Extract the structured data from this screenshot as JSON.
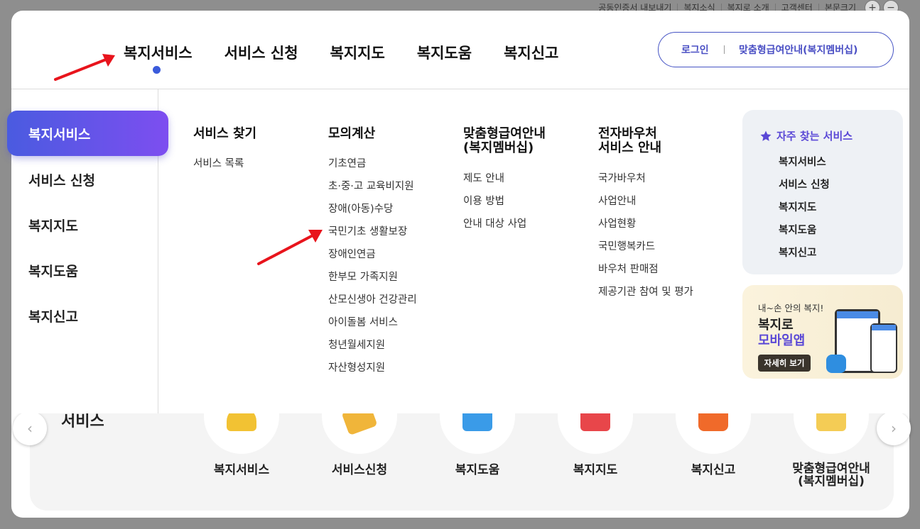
{
  "utility_links": [
    "공동인증서 내보내기",
    "복지소식",
    "복지로 소개",
    "고객센터",
    "본문크기"
  ],
  "zoom": {
    "plus": "+",
    "minus": "−"
  },
  "gnb": [
    "복지서비스",
    "서비스 신청",
    "복지지도",
    "복지도움",
    "복지신고"
  ],
  "login": {
    "login_label": "로그인",
    "member_label": "맞춤형급여안내(복지멤버십)"
  },
  "side_menu": {
    "active": "복지서비스",
    "items": [
      "서비스 신청",
      "복지지도",
      "복지도움",
      "복지신고"
    ]
  },
  "columns": [
    {
      "title": "서비스 찾기",
      "items": [
        "서비스 목록"
      ]
    },
    {
      "title": "모의계산",
      "items": [
        "기초연금",
        "초·중·고 교육비지원",
        "장애(아동)수당",
        "국민기초 생활보장",
        "장애인연금",
        "한부모 가족지원",
        "산모신생아 건강관리",
        "아이돌봄 서비스",
        "청년월세지원",
        "자산형성지원"
      ]
    },
    {
      "title_line1": "맞춤형급여안내",
      "title_line2": "(복지멤버십)",
      "items": [
        "제도 안내",
        "이용 방법",
        "안내 대상 사업"
      ]
    },
    {
      "title_line1": "전자바우처",
      "title_line2": "서비스 안내",
      "items": [
        "국가바우처",
        "사업안내",
        "사업현황",
        "국민행복카드",
        "바우처 판매점",
        "제공기관 참여 및 평가"
      ]
    }
  ],
  "favorites": {
    "title": "자주 찾는 서비스",
    "items": [
      "복지서비스",
      "서비스 신청",
      "복지지도",
      "복지도움",
      "복지신고"
    ]
  },
  "app_banner": {
    "line1": "내~손 안의 복지!",
    "line2": "복지로",
    "line3": "모바일앱",
    "button": "자세히 보기"
  },
  "background": {
    "section_title": "서비스",
    "services": [
      "복지서비스",
      "서비스신청",
      "복지도움",
      "복지지도",
      "복지신고",
      "맞춤형급여안내\n(복지멤버십)"
    ],
    "prev": "‹",
    "next": "›"
  },
  "colors": {
    "accent": "#4a4fc4",
    "gradient_start": "#4a5be0",
    "gradient_end": "#7d4ef0",
    "annotation": "#e8141c"
  }
}
